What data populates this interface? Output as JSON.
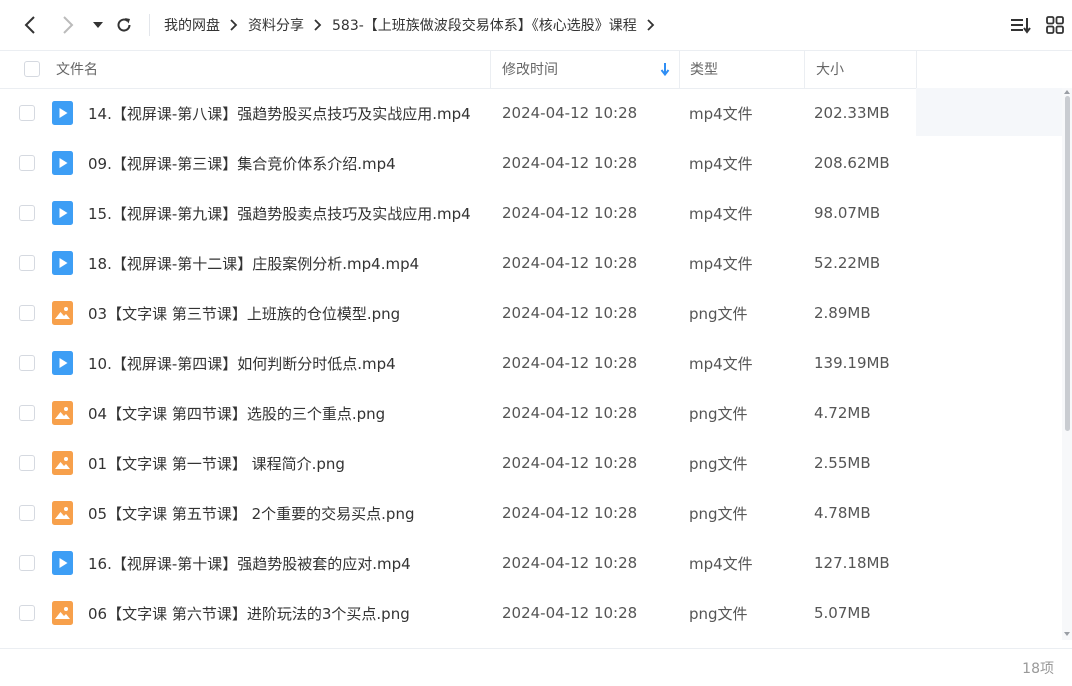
{
  "toolbar": {
    "breadcrumbs": [
      "我的网盘",
      "资料分享",
      "583-【上班族做波段交易体系】《核心选股》课程"
    ]
  },
  "table": {
    "headers": {
      "name": "文件名",
      "modified": "修改时间",
      "type": "类型",
      "size": "大小"
    },
    "rows": [
      {
        "name": "14.【视屏课-第八课】强趋势股买点技巧及实战应用.mp4",
        "time": "2024-04-12 10:28",
        "type": "mp4文件",
        "size": "202.33MB",
        "icon": "video-file-icon"
      },
      {
        "name": "09.【视屏课-第三课】集合竞价体系介绍.mp4",
        "time": "2024-04-12 10:28",
        "type": "mp4文件",
        "size": "208.62MB",
        "icon": "video-file-icon"
      },
      {
        "name": "15.【视屏课-第九课】强趋势股卖点技巧及实战应用.mp4",
        "time": "2024-04-12 10:28",
        "type": "mp4文件",
        "size": "98.07MB",
        "icon": "video-file-icon"
      },
      {
        "name": "18.【视屏课-第十二课】庄股案例分析.mp4.mp4",
        "time": "2024-04-12 10:28",
        "type": "mp4文件",
        "size": "52.22MB",
        "icon": "video-file-icon"
      },
      {
        "name": "03【文字课 第三节课】上班族的仓位模型.png",
        "time": "2024-04-12 10:28",
        "type": "png文件",
        "size": "2.89MB",
        "icon": "image-file-icon"
      },
      {
        "name": "10.【视屏课-第四课】如何判断分时低点.mp4",
        "time": "2024-04-12 10:28",
        "type": "mp4文件",
        "size": "139.19MB",
        "icon": "video-file-icon"
      },
      {
        "name": "04【文字课 第四节课】选股的三个重点.png",
        "time": "2024-04-12 10:28",
        "type": "png文件",
        "size": "4.72MB",
        "icon": "image-file-icon"
      },
      {
        "name": "01【文字课 第一节课】 课程简介.png",
        "time": "2024-04-12 10:28",
        "type": "png文件",
        "size": "2.55MB",
        "icon": "image-file-icon"
      },
      {
        "name": "05【文字课 第五节课】 2个重要的交易买点.png",
        "time": "2024-04-12 10:28",
        "type": "png文件",
        "size": "4.78MB",
        "icon": "image-file-icon"
      },
      {
        "name": "16.【视屏课-第十课】强趋势股被套的应对.mp4",
        "time": "2024-04-12 10:28",
        "type": "mp4文件",
        "size": "127.18MB",
        "icon": "video-file-icon"
      },
      {
        "name": "06【文字课 第六节课】进阶玩法的3个买点.png",
        "time": "2024-04-12 10:28",
        "type": "png文件",
        "size": "5.07MB",
        "icon": "image-file-icon"
      }
    ]
  },
  "footer": {
    "count": "18项"
  },
  "colors": {
    "video": "#3d9ef5",
    "image": "#f7a04b",
    "accent": "#2f8ef4"
  }
}
